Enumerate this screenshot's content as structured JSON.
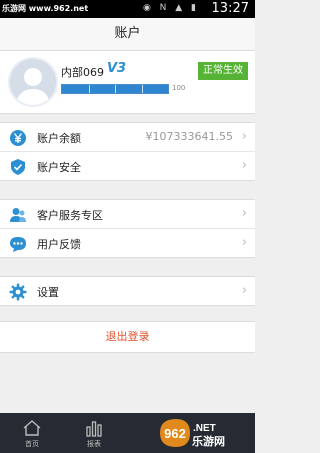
{
  "status_bar": {
    "watermark": "乐游网 www.962.net",
    "time": "13:27"
  },
  "header": {
    "title": "账户"
  },
  "profile": {
    "name": "内部069",
    "vip_level": "V3",
    "status_button": "正常生效",
    "progress_value": "100",
    "progress_fraction": 1.0
  },
  "account_group": [
    {
      "label": "账户余额",
      "value": "¥107333641.55",
      "icon": "yen-icon"
    },
    {
      "label": "账户安全",
      "value": "",
      "icon": "shield-icon"
    }
  ],
  "service_group": [
    {
      "label": "客户服务专区",
      "icon": "customer-service-icon"
    },
    {
      "label": "用户反馈",
      "icon": "feedback-icon"
    }
  ],
  "settings_group": [
    {
      "label": "设置",
      "icon": "gear-icon"
    }
  ],
  "logout_label": "退出登录",
  "tabbar": [
    {
      "label": "首页",
      "icon": "home-icon"
    },
    {
      "label": "报表",
      "icon": "chart-icon"
    }
  ],
  "brand_logo_text": "962.NET 乐游网",
  "colors": {
    "accent_blue": "#2c8fd1",
    "status_green": "#56b335",
    "logout_red": "#e5532e",
    "tabbar_bg": "#262b33"
  }
}
